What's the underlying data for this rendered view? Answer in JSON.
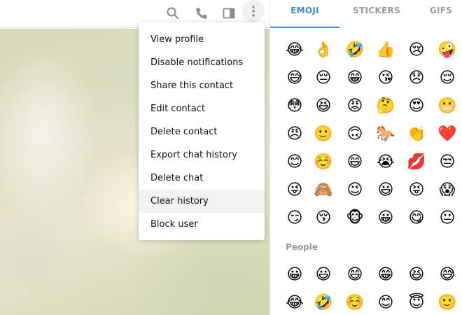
{
  "header": {
    "icons": [
      "search-icon",
      "phone-icon",
      "side-panel-icon",
      "more-vertical-icon"
    ]
  },
  "menu": {
    "items": [
      {
        "label": "View profile"
      },
      {
        "label": "Disable notifications"
      },
      {
        "label": "Share this contact"
      },
      {
        "label": "Edit contact"
      },
      {
        "label": "Delete contact"
      },
      {
        "label": "Export chat history"
      },
      {
        "label": "Delete chat"
      },
      {
        "label": "Clear history"
      },
      {
        "label": "Block user"
      }
    ],
    "hovered_index": 7
  },
  "emoji_panel": {
    "tabs": [
      {
        "label": "EMOJI",
        "active": true
      },
      {
        "label": "STICKERS",
        "active": false
      },
      {
        "label": "GIFS",
        "active": false
      }
    ],
    "accent_color": "#3b8fd1",
    "section_title": "People",
    "recent_rows": [
      [
        "😂",
        "👌",
        "🤣",
        "👍",
        "😢",
        "🤪"
      ],
      [
        "😅",
        "😔",
        "😁",
        "😘",
        "😞",
        "😌"
      ],
      [
        "😳",
        "😆",
        "😡",
        "🤔",
        "😍",
        "😬"
      ],
      [
        "😠",
        "🙂",
        "🙃",
        "🐎",
        "👏",
        "❤️"
      ],
      [
        "😊",
        "☺️",
        "😄",
        "😭",
        "💋",
        "😒"
      ],
      [
        "😜",
        "🙈",
        "😉",
        "😃",
        "😝",
        "😱"
      ],
      [
        "😏",
        "😚",
        "🐵",
        "😀",
        "😋",
        "😐"
      ]
    ],
    "people_rows": [
      [
        "😀",
        "😃",
        "😄",
        "😁",
        "😆",
        "😅"
      ],
      [
        "😂",
        "🤣",
        "☺️",
        "😊",
        "😇",
        "🙂"
      ]
    ]
  }
}
